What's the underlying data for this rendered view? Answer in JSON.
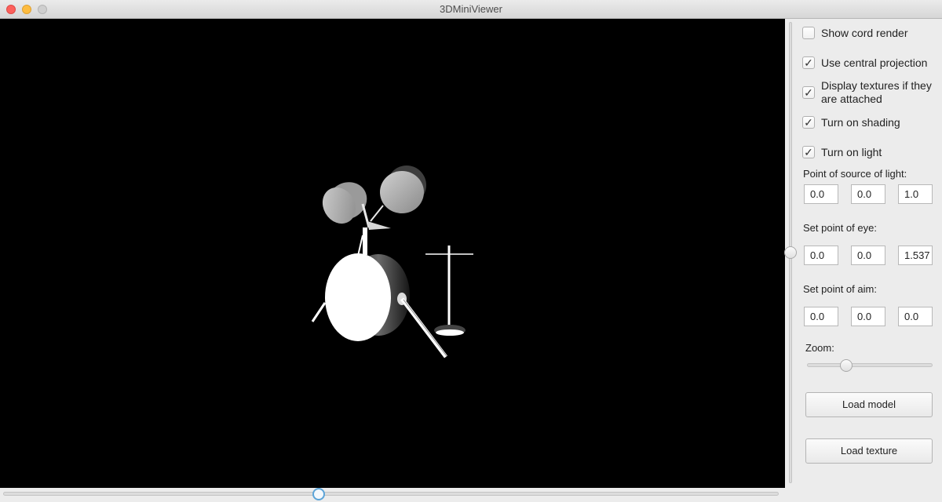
{
  "window": {
    "title": "3DMiniViewer"
  },
  "options": [
    {
      "label": "Show cord render",
      "checked": false
    },
    {
      "label": "Use central projection",
      "checked": true
    },
    {
      "label": "Display textures if they are attached",
      "checked": true
    },
    {
      "label": "Turn on shading",
      "checked": true
    },
    {
      "label": "Turn on light",
      "checked": true
    }
  ],
  "light": {
    "label": "Point of source of light:",
    "x": "0.0",
    "y": "0.0",
    "z": "1.0"
  },
  "eye": {
    "label": "Set point of eye:",
    "x": "0.0",
    "y": "0.0",
    "z": "1.537"
  },
  "aim": {
    "label": "Set point of aim:",
    "x": "0.0",
    "y": "0.0",
    "z": "0.0"
  },
  "zoom": {
    "label": "Zoom:"
  },
  "buttons": {
    "load_model": "Load model",
    "load_texture": "Load texture"
  },
  "colors": {
    "viewport_bg": "#000000",
    "slider_accent": "#5ca4d8"
  }
}
